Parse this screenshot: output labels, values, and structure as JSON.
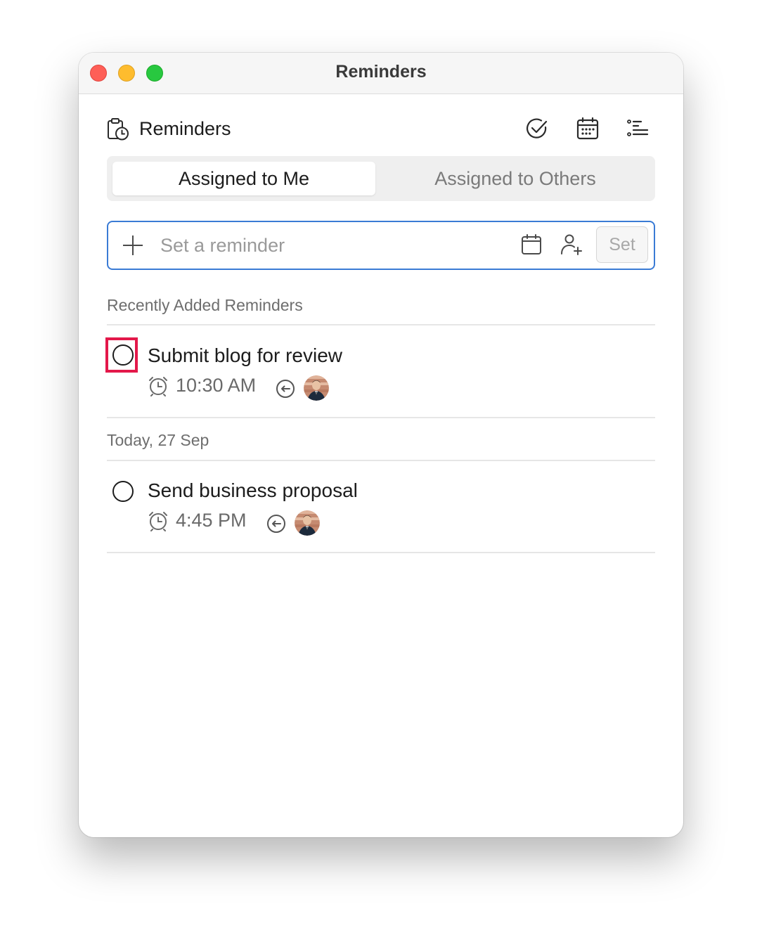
{
  "window": {
    "title": "Reminders"
  },
  "header": {
    "app_name": "Reminders",
    "icons": [
      "clipboard-clock-icon",
      "check-circle-icon",
      "calendar-icon",
      "list-icon"
    ]
  },
  "tabs": [
    {
      "label": "Assigned to Me",
      "active": true
    },
    {
      "label": "Assigned to Others",
      "active": false
    }
  ],
  "add_reminder": {
    "placeholder": "Set a reminder",
    "value": "",
    "set_label": "Set",
    "icons": [
      "plus-icon",
      "calendar-icon",
      "add-user-icon"
    ]
  },
  "sections": [
    {
      "label": "Recently Added Reminders",
      "tasks": [
        {
          "title": "Submit blog for review",
          "time": "10:30 AM",
          "completed": false,
          "highlighted": true
        }
      ]
    },
    {
      "label": "Today, 27 Sep",
      "tasks": [
        {
          "title": "Send business proposal",
          "time": "4:45 PM",
          "completed": false,
          "highlighted": false
        }
      ]
    }
  ],
  "colors": {
    "accent": "#3a7bd5",
    "highlight": "#e3184a",
    "traffic_red": "#fe5f57",
    "traffic_yellow": "#febc2e",
    "traffic_green": "#28c840"
  }
}
